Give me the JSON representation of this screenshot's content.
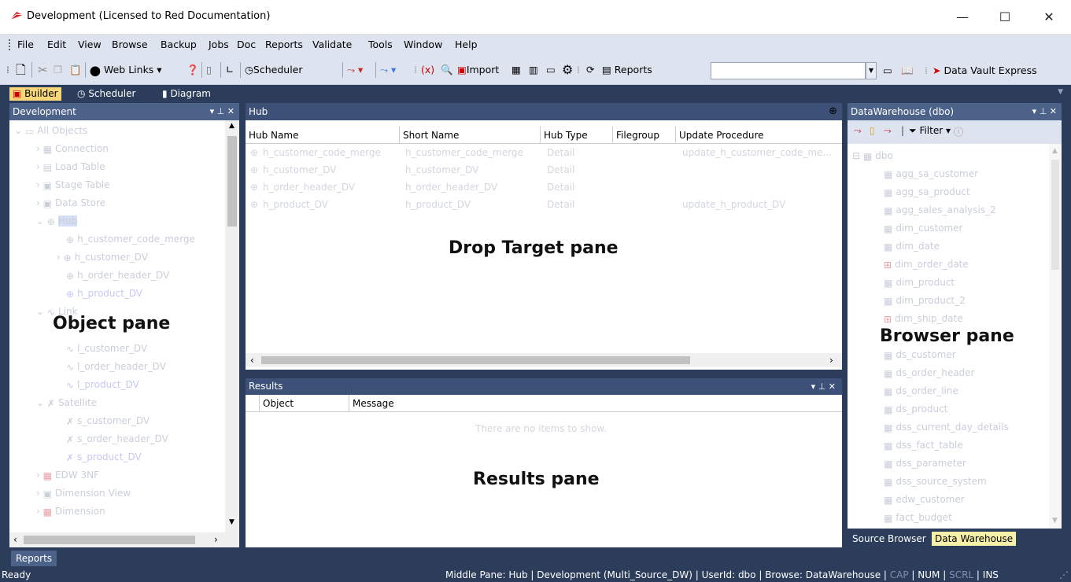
{
  "window": {
    "title": "Development (Licensed to Red Documentation)"
  },
  "menu": [
    "File",
    "Edit",
    "View",
    "Browse",
    "Backup",
    "Jobs",
    "Doc",
    "Reports",
    "Validate",
    "Tools",
    "Window",
    "Help"
  ],
  "toolbar": {
    "web_links": "Web Links",
    "scheduler": "Scheduler",
    "import": "Import",
    "reports": "Reports",
    "reports_box_value": "",
    "data_vault": "Data Vault Express"
  },
  "tabs": {
    "builder": "Builder",
    "scheduler": "Scheduler",
    "diagram": "Diagram"
  },
  "object_pane": {
    "title": "Development",
    "items": [
      {
        "label": "All Objects"
      },
      {
        "label": "Connection"
      },
      {
        "label": "Load Table"
      },
      {
        "label": "Stage Table"
      },
      {
        "label": "Data Store"
      },
      {
        "label": "Hub"
      },
      {
        "label": "h_customer_code_merge"
      },
      {
        "label": "h_customer_DV"
      },
      {
        "label": "h_order_header_DV"
      },
      {
        "label": "h_product_DV"
      },
      {
        "label": "Link"
      },
      {
        "label": "l_customer_DV"
      },
      {
        "label": "l_order_header_DV"
      },
      {
        "label": "l_product_DV"
      },
      {
        "label": "Satellite"
      },
      {
        "label": "s_customer_DV"
      },
      {
        "label": "s_order_header_DV"
      },
      {
        "label": "s_product_DV"
      },
      {
        "label": "EDW 3NF"
      },
      {
        "label": "Dimension View"
      },
      {
        "label": "Dimension"
      }
    ],
    "overlay_label": "Object pane"
  },
  "hub_pane": {
    "title": "Hub",
    "columns": [
      "Hub Name",
      "Short Name",
      "Hub Type",
      "Filegroup",
      "Update Procedure"
    ],
    "rows": [
      [
        "h_customer_code_merge",
        "h_customer_code_merge",
        "Detail",
        "",
        "update_h_customer_code_me..."
      ],
      [
        "h_customer_DV",
        "h_customer_DV",
        "Detail",
        "",
        ""
      ],
      [
        "h_order_header_DV",
        "h_order_header_DV",
        "Detail",
        "",
        ""
      ],
      [
        "h_product_DV",
        "h_product_DV",
        "Detail",
        "",
        "update_h_product_DV"
      ]
    ],
    "overlay_label": "Drop Target pane"
  },
  "results_pane": {
    "title": "Results",
    "columns": [
      "Object",
      "Message"
    ],
    "empty_text": "There are no items to show.",
    "overlay_label": "Results pane"
  },
  "browser_pane": {
    "title": "DataWarehouse (dbo)",
    "filter": "Filter",
    "root": "dbo",
    "items": [
      "agg_sa_customer",
      "agg_sa_product",
      "agg_sales_analysis_2",
      "dim_customer",
      "dim_date",
      "dim_order_date",
      "dim_product",
      "dim_product_2",
      "dim_ship_date",
      "ds_customer",
      "ds_order_header",
      "ds_order_line",
      "ds_product",
      "dss_current_day_details",
      "dss_fact_table",
      "dss_parameter",
      "dss_source_system",
      "edw_customer",
      "fact_budget"
    ],
    "overlay_label": "Browser pane",
    "tabs": [
      "Source Browser",
      "Data Warehouse"
    ]
  },
  "reports_tab": "Reports",
  "status": {
    "left": "Ready",
    "middle": "Middle Pane: Hub",
    "connection": "Development (Multi_Source_DW)",
    "user": "UserId: dbo",
    "browse": "Browse: DataWarehouse",
    "cap": "CAP",
    "num": "NUM",
    "scrl": "SCRL",
    "ins": "INS"
  }
}
